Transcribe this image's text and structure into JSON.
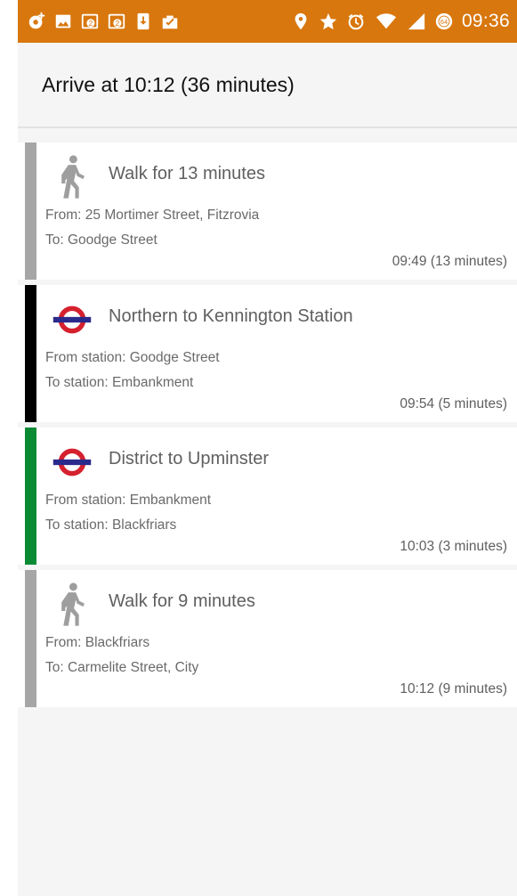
{
  "status_bar": {
    "icons": [
      "location-plus-icon",
      "image-icon",
      "gallery-badge-icon",
      "gallery-badge-icon",
      "download-icon",
      "clipboard-check-icon"
    ],
    "right_icons": [
      "location-pin-icon",
      "star-icon",
      "alarm-icon",
      "wifi-icon",
      "signal-icon",
      "data-saver-icon"
    ],
    "badge_number": "2",
    "data_badge": "64",
    "time": "09:36",
    "color": "#d8770d"
  },
  "header": {
    "title": "Arrive at 10:12 (36 minutes)"
  },
  "legs": [
    {
      "mode": "walk",
      "icon": "walk-icon",
      "color": "#a6a6a6",
      "title": "Walk for 13 minutes",
      "from": "From: 25 Mortimer Street, Fitzrovia",
      "to": "To: Goodge Street",
      "time": "09:49 (13 minutes)"
    },
    {
      "mode": "tube",
      "icon": "underground-roundel-icon",
      "color": "#000000",
      "title": "Northern to Kennington Station",
      "from": "From station: Goodge Street",
      "to": "To station: Embankment",
      "time": "09:54 (5 minutes)"
    },
    {
      "mode": "tube",
      "icon": "underground-roundel-icon",
      "color": "#0b8a34",
      "title": "District to Upminster",
      "from": "From station: Embankment",
      "to": "To station: Blackfriars",
      "time": "10:03 (3 minutes)"
    },
    {
      "mode": "walk",
      "icon": "walk-icon",
      "color": "#a6a6a6",
      "title": "Walk for 9 minutes",
      "from": "From: Blackfriars",
      "to": "To: Carmelite Street, City",
      "time": "10:12 (9 minutes)"
    }
  ],
  "roundel_colors": {
    "ring": "#d5212e",
    "bar": "#2a2a8c"
  }
}
